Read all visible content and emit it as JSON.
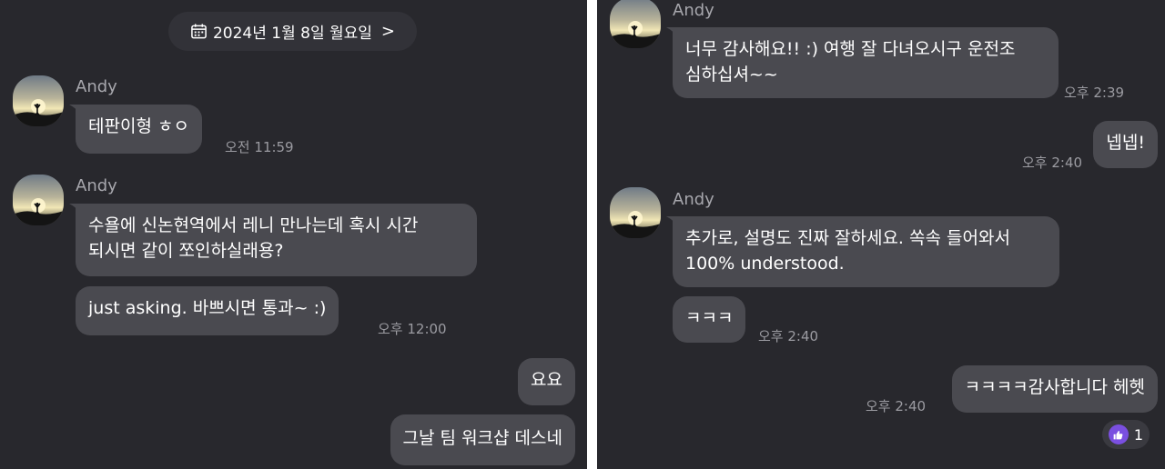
{
  "left": {
    "date_divider": {
      "label": "2024년 1월 8일 월요일",
      "icon": "calendar-icon",
      "chevron": ">"
    },
    "groups": [
      {
        "sender": "Andy",
        "messages": [
          {
            "text": "테판이형 ㅎㅇ",
            "time": "오전 11:59"
          }
        ]
      },
      {
        "sender": "Andy",
        "messages": [
          {
            "text_lines": [
              "수욜에 신논현역에서 레니 만나는데 혹시 시간",
              "되시면 같이 쪼인하실래용?"
            ]
          },
          {
            "text": "just asking. 바쁘시면 통과~ :)",
            "time": "오후 12:00"
          }
        ]
      }
    ],
    "outgoing": [
      {
        "text": "요요"
      },
      {
        "text": "그날 팀 워크샵 데스네"
      }
    ]
  },
  "right": {
    "groups": [
      {
        "sender": "Andy",
        "messages": [
          {
            "text_lines": [
              "너무 감사해요!! :) 여행 잘 다녀오시구 운전조",
              "심하십셔~~"
            ],
            "time": "오후 2:39"
          }
        ]
      },
      {
        "sender": "Andy",
        "messages": [
          {
            "text_lines": [
              "추가로, 설명도 진짜 잘하세요. 쏙속 들어와서",
              "100% understood."
            ]
          },
          {
            "text": "ㅋㅋㅋ",
            "time": "오후 2:40"
          }
        ]
      }
    ],
    "outgoing": [
      {
        "text": "넵넵!",
        "time": "오후 2:40"
      },
      {
        "text": "ㅋㅋㅋㅋ감사합니다 헤헷",
        "time": "오후 2:40",
        "reaction": {
          "icon": "thumbs-up-icon",
          "count": "1"
        }
      }
    ]
  },
  "colors": {
    "background": "#28282d",
    "bubble": "#4a4a50",
    "timestamp": "#9b9ba1",
    "reaction_accent": "#7a4fe0"
  }
}
